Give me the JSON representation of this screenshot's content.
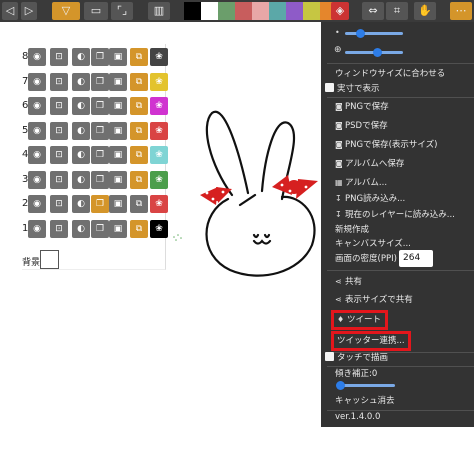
{
  "toolbar": {
    "swatches": [
      "#000000",
      "#ffffff",
      "#6b9e6b",
      "#c85d5d",
      "#e8a7a7",
      "#5ba8a8",
      "#8e5bc8",
      "#c6c642",
      "#e5862c"
    ]
  },
  "layers": {
    "rows": [
      {
        "num": "8",
        "on": [
          5
        ],
        "blend_color": "#444444"
      },
      {
        "num": "7",
        "on": [
          5,
          6
        ],
        "blend_color": "#e3c32d"
      },
      {
        "num": "6",
        "on": [
          5
        ],
        "blend_color": "#d033d0"
      },
      {
        "num": "5",
        "on": [
          5
        ],
        "blend_color": "#d94444"
      },
      {
        "num": "4",
        "on": [
          5
        ],
        "blend_color": "#7fd4d4"
      },
      {
        "num": "3",
        "on": [
          5
        ],
        "blend_color": "#4b9e4b"
      },
      {
        "num": "2",
        "on": [
          3
        ],
        "blend_color": "#d94444"
      },
      {
        "num": "1",
        "on": [
          5
        ],
        "blend_color": "#000000"
      }
    ],
    "background_label": "背景"
  },
  "menu": {
    "fit_window": "ウィンドウサイズに合わせる",
    "actual_size": "実寸で表示",
    "save_png": "PNGで保存",
    "save_psd": "PSDで保存",
    "save_png_display": "PNGで保存(表示サイズ)",
    "save_album": "アルバムへ保存",
    "album": "アルバム...",
    "load_png": "PNG読み込み...",
    "load_into_layer": "現在のレイヤーに読み込み...",
    "new": "新規作成",
    "canvas_size": "キャンバスサイズ...",
    "ppi_label": "画面の密度(PPI)",
    "ppi_value": "264",
    "share": "共有",
    "share_display": "表示サイズで共有",
    "tweet": "ツイート",
    "twitter_link": "ツイッター連携...",
    "touch_draw": "タッチで描画",
    "tilt_label": "傾き補正:0",
    "clear_cache": "キャッシュ消去",
    "version": "ver.1.4.0.0"
  },
  "colors": {
    "highlight": "#e3161c",
    "accent": "#d4952a",
    "menu_bg": "#333333"
  }
}
